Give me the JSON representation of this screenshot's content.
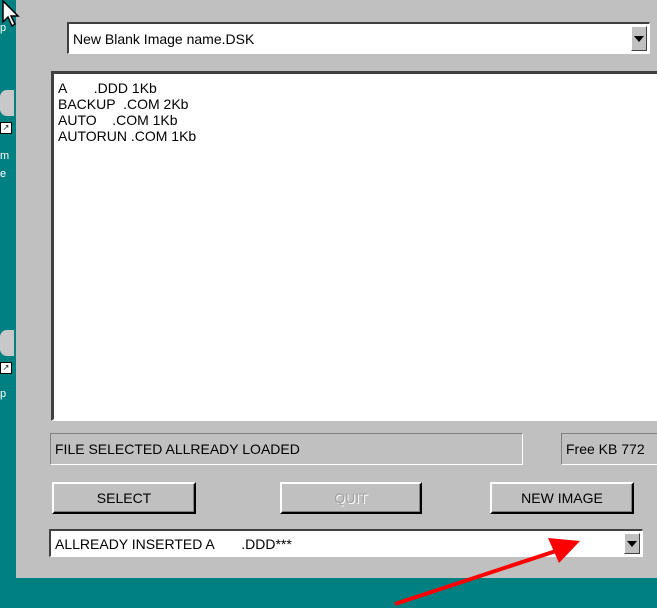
{
  "desktop": {
    "labels": [
      "p",
      "m",
      "e",
      "p"
    ]
  },
  "top_combo": {
    "value": "New Blank Image name.DSK"
  },
  "file_list": {
    "items": [
      "A       .DDD 1Kb",
      "BACKUP  .COM 2Kb",
      "AUTO    .COM 1Kb",
      "AUTORUN .COM 1Kb"
    ]
  },
  "status": {
    "message": "FILE SELECTED ALLREADY LOADED",
    "free": "Free KB 772"
  },
  "buttons": {
    "select": "SELECT",
    "quit": "QUIT",
    "new_image": "NEW IMAGE"
  },
  "bottom_combo": {
    "value": "ALLREADY INSERTED A       .DDD***"
  },
  "colors": {
    "desktop": "#008080",
    "window": "#c0c0c0",
    "annotation_arrow": "#ff0000"
  }
}
